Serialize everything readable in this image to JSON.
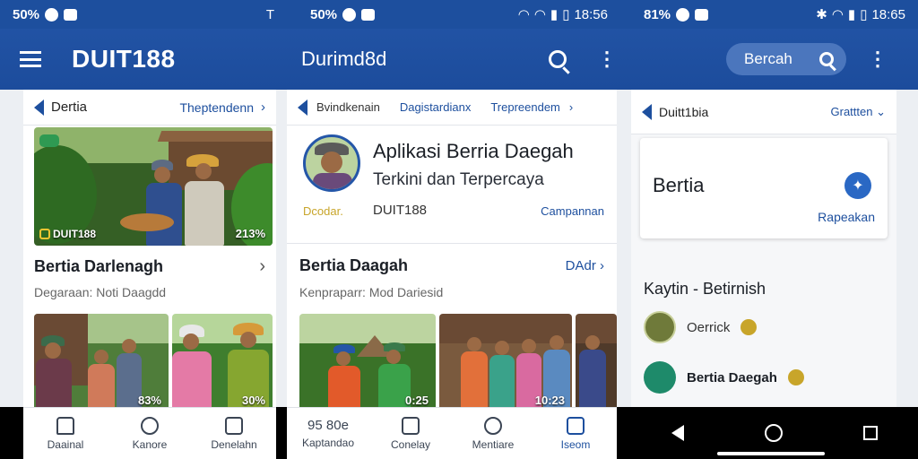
{
  "panel1": {
    "status": {
      "left": "50%",
      "right": "T"
    },
    "app_title": "DUIT188",
    "breadcrumb": {
      "back": "Dertia",
      "right": "Theptendenn"
    },
    "hero": {
      "badge": "DUIT188",
      "stat": "213%"
    },
    "section_title": "Bertia Darlenagh",
    "section_sub": "Degaraan: Noti Daagdd",
    "thumbs": [
      {
        "num": "83%"
      },
      {
        "num": "30%"
      }
    ],
    "nav": [
      {
        "label": "Daainal"
      },
      {
        "label": "Kanore"
      },
      {
        "label": "Denelahn"
      }
    ]
  },
  "panel2": {
    "status": {
      "left": "50%",
      "right": "18:56"
    },
    "app_title": "Durimd8d",
    "tabs": [
      "Bvindkenain",
      "Dagistardianx",
      "Trepreendem"
    ],
    "headline": "Aplikasi Berria Daegah",
    "subline": "Terkini dan Terpercaya",
    "publisher_tag": "Dcodar.",
    "publisher": "DUIT188",
    "campaign": "Campannan",
    "section_title": "Bertia Daagah",
    "section_link": "DAdr",
    "section_sub": "Kenpraparr: Mod Dariesid",
    "thumbs": [
      {
        "num": "0:25"
      },
      {
        "num": "10:23"
      }
    ],
    "nav": [
      {
        "label": "Kaptandao",
        "top": "95 80e"
      },
      {
        "label": "Conelay"
      },
      {
        "label": "Mentiare"
      },
      {
        "label": "Iseom"
      }
    ]
  },
  "panel3": {
    "status": {
      "left": "81%",
      "right": "18:65"
    },
    "search_label": "Bercah",
    "breadcrumb": {
      "back": "Duitt1bia",
      "right": "Grattten"
    },
    "card_title": "Bertia",
    "card_link": "Rapeakan",
    "list_title": "Kaytin - Betirnish",
    "list": [
      {
        "label": "Oerrick"
      },
      {
        "label": "Bertia Daegah"
      }
    ]
  },
  "colors": {
    "brand": "#1d4f9e",
    "accent": "#c8a52a"
  }
}
